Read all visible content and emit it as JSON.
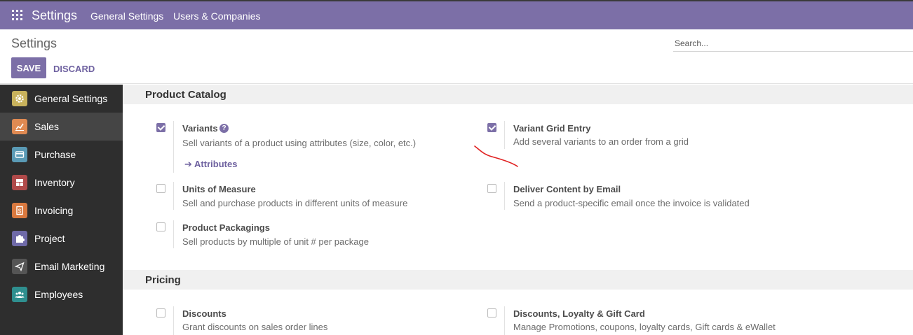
{
  "topbar": {
    "brand": "Settings",
    "menu": [
      "General Settings",
      "Users & Companies"
    ]
  },
  "control_panel": {
    "title": "Settings",
    "search_placeholder": "Search...",
    "save_label": "SAVE",
    "discard_label": "DISCARD"
  },
  "sidebar": {
    "items": [
      {
        "label": "General Settings",
        "icon": "gear-icon",
        "color": "#c8b25c"
      },
      {
        "label": "Sales",
        "icon": "chart-icon",
        "color": "#e08a52"
      },
      {
        "label": "Purchase",
        "icon": "credit-card-icon",
        "color": "#5a9ab5"
      },
      {
        "label": "Inventory",
        "icon": "boxes-icon",
        "color": "#b04a4a"
      },
      {
        "label": "Invoicing",
        "icon": "invoice-icon",
        "color": "#d9793f"
      },
      {
        "label": "Project",
        "icon": "puzzle-icon",
        "color": "#6f6aa8"
      },
      {
        "label": "Email Marketing",
        "icon": "paper-plane-icon",
        "color": "#555555"
      },
      {
        "label": "Employees",
        "icon": "people-icon",
        "color": "#2f8f8f"
      }
    ],
    "active_index": 1
  },
  "sections": {
    "catalog": {
      "title": "Product Catalog",
      "variants": {
        "title": "Variants",
        "desc": "Sell variants of a product using attributes (size, color, etc.)",
        "link": "Attributes",
        "checked": true
      },
      "grid": {
        "title": "Variant Grid Entry",
        "desc": "Add several variants to an order from a grid",
        "checked": true
      },
      "uom": {
        "title": "Units of Measure",
        "desc": "Sell and purchase products in different units of measure",
        "checked": false
      },
      "email": {
        "title": "Deliver Content by Email",
        "desc": "Send a product-specific email once the invoice is validated",
        "checked": false
      },
      "packaging": {
        "title": "Product Packagings",
        "desc": "Sell products by multiple of unit # per package",
        "checked": false
      }
    },
    "pricing": {
      "title": "Pricing",
      "discounts": {
        "title": "Discounts",
        "desc": "Grant discounts on sales order lines",
        "checked": false
      },
      "loyalty": {
        "title": "Discounts, Loyalty & Gift Card",
        "desc": "Manage Promotions, coupons, loyalty cards, Gift cards & eWallet",
        "checked": false
      }
    }
  },
  "colors": {
    "brand": "#7c6fa7",
    "annotation": "#e02020"
  }
}
